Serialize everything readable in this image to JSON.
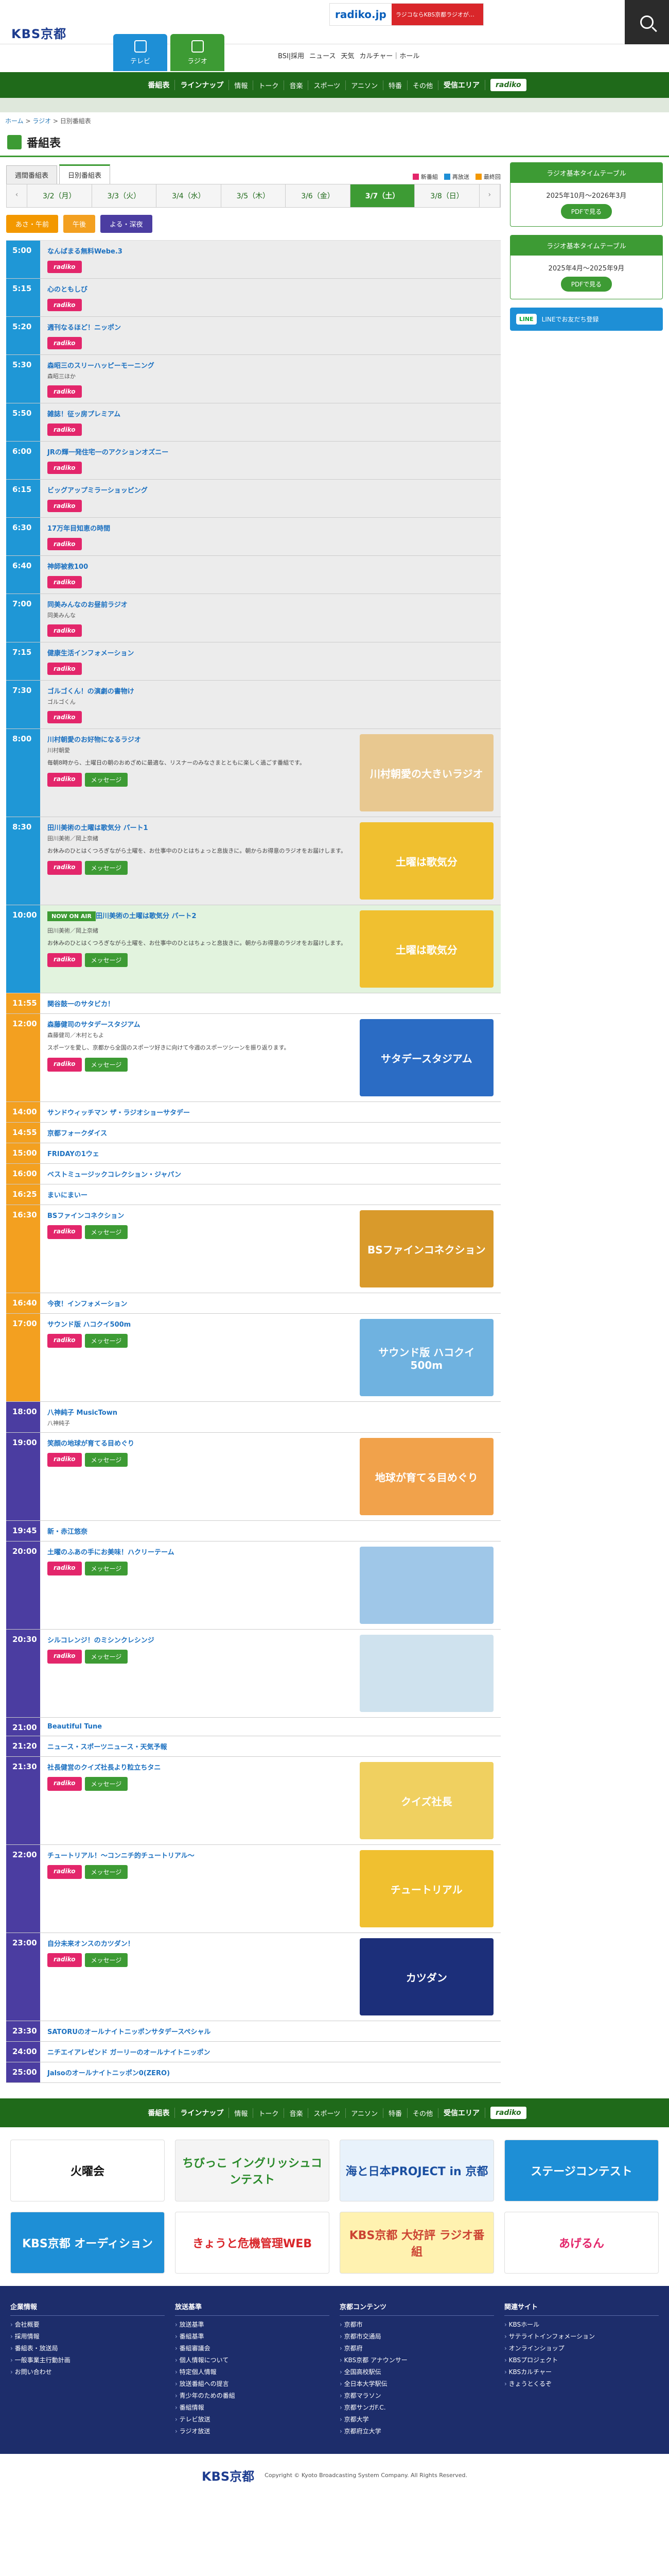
{
  "header": {
    "logo": "KBS京都",
    "tabs": [
      {
        "label": "テレビ"
      },
      {
        "label": "ラジオ"
      }
    ],
    "nav": [
      "BSI|採用",
      "ニュース",
      "天気",
      "カルチャー｜ホール"
    ],
    "radiko_logo": "radiko.jp",
    "radiko_text": "ラジコならKBS京都ラジオが…"
  },
  "greennav": {
    "items": [
      "番組表",
      "ラインナップ",
      "情報",
      "トーク",
      "音楽",
      "スポーツ",
      "アニソン",
      "特番",
      "その他",
      "受信エリア"
    ],
    "radiko": "radiko"
  },
  "breadcrumb": [
    "ホーム",
    "ラジオ",
    "日別番組表"
  ],
  "page": {
    "title": "番組表"
  },
  "viewtabs": [
    "週間番組表",
    "日別番組表"
  ],
  "legend": [
    {
      "label": "新番組",
      "color": "#e3266b"
    },
    {
      "label": "再放送",
      "color": "#1e8fd6"
    },
    {
      "label": "最終回",
      "color": "#f39800"
    }
  ],
  "days": [
    "3/2（月）",
    "3/3（火）",
    "3/4（水）",
    "3/5（木）",
    "3/6（金）",
    "3/7（土）",
    "3/8（日）"
  ],
  "dayparts": [
    "あさ・午前",
    "午後",
    "よる・深夜"
  ],
  "buttons": {
    "radiko": "radiko",
    "message": "メッセージ"
  },
  "programs": [
    {
      "time": "5:00",
      "title": "なんばまる無料Webe.3",
      "cast": "",
      "desc": "",
      "radiko": true,
      "msg": false,
      "band": "morning"
    },
    {
      "time": "5:15",
      "title": "心のともしび",
      "cast": "",
      "desc": "",
      "radiko": true,
      "msg": false,
      "band": "morning"
    },
    {
      "time": "5:20",
      "title": "週刊なるほど！ニッポン",
      "cast": "",
      "desc": "",
      "radiko": true,
      "msg": false,
      "band": "morning"
    },
    {
      "time": "5:30",
      "title": "森昭三のスリーハッピーモーニング",
      "cast": "森昭三ほか",
      "desc": "",
      "radiko": true,
      "msg": false,
      "band": "morning"
    },
    {
      "time": "5:50",
      "title": "雑誌！征ッ房プレミアム",
      "cast": "",
      "desc": "",
      "radiko": true,
      "msg": false,
      "band": "morning"
    },
    {
      "time": "6:00",
      "title": "JRの輝一発住宅一のアクションオズニー",
      "cast": "",
      "desc": "",
      "radiko": true,
      "msg": false,
      "band": "morning"
    },
    {
      "time": "6:15",
      "title": "ビッグアップミラーショッピング",
      "cast": "",
      "desc": "",
      "radiko": true,
      "msg": false,
      "band": "morning"
    },
    {
      "time": "6:30",
      "title": "17万年目知恵の時間",
      "cast": "",
      "desc": "",
      "radiko": true,
      "msg": false,
      "band": "morning"
    },
    {
      "time": "6:40",
      "title": "神師被救100",
      "cast": "",
      "desc": "",
      "radiko": true,
      "msg": false,
      "band": "morning"
    },
    {
      "time": "7:00",
      "title": "同美みんなのお昼前ラジオ",
      "cast": "同美みんな",
      "desc": "",
      "radiko": true,
      "msg": false,
      "band": "morning"
    },
    {
      "time": "7:15",
      "title": "健康生活インフォメーション",
      "cast": "",
      "desc": "",
      "radiko": true,
      "msg": false,
      "band": "morning"
    },
    {
      "time": "7:30",
      "title": "ゴルゴくん！の演劇の書物け",
      "cast": "ゴルゴくん",
      "desc": "",
      "radiko": true,
      "msg": false,
      "band": "morning"
    },
    {
      "time": "8:00",
      "title": "川村朝愛のお好物になるラジオ",
      "cast": "川村朝愛",
      "desc": "毎朝8時から、土曜日の朝のおめざめに最適な、リスナーのみなさまとともに楽しく過ごす番組です。",
      "radiko": true,
      "msg": true,
      "band": "morning",
      "img": "川村朝愛の大きいラジオ",
      "imgc": "#e8c890"
    },
    {
      "time": "8:30",
      "title": "田川美術の土曜は歌気分 パート1",
      "cast": "田川美術／岡上奈緒",
      "desc": "お休みのひとはくつろぎながら土曜を、お仕事中のひとはちょっと息抜きに。朝からお得意のラジオをお届けします。",
      "radiko": true,
      "msg": true,
      "band": "morning",
      "img": "土曜は歌気分",
      "imgc": "#f0c030"
    },
    {
      "time": "10:00",
      "title": "田川美術の土曜は歌気分 パート2",
      "cast": "田川美術／岡上奈緒",
      "desc": "お休みのひとはくつろぎながら土曜を、お仕事中のひとはちょっと息抜きに。朝からお得意のラジオをお届けします。",
      "radiko": true,
      "msg": true,
      "band": "morning",
      "live": true,
      "onair": "NOW ON AIR",
      "img": "土曜は歌気分",
      "imgc": "#f0c030"
    },
    {
      "time": "11:55",
      "title": "関谷鼓一のサタビカ！",
      "cast": "",
      "desc": "",
      "radiko": false,
      "msg": false,
      "band": "noon"
    },
    {
      "time": "12:00",
      "title": "森藤健司のサタデースタジアム",
      "cast": "森藤健司／木村ともよ",
      "desc": "スポーツを愛し、京都から全国のスポーツ好きに向けて今週のスポーツシーンを振り返ります。",
      "radiko": true,
      "msg": true,
      "band": "noon",
      "img": "サタデースタジアム",
      "imgc": "#2b6cc4"
    },
    {
      "time": "14:00",
      "title": "サンドウィッチマン ザ・ラジオショーサタデー",
      "cast": "",
      "desc": "",
      "radiko": false,
      "msg": false,
      "band": "noon"
    },
    {
      "time": "14:55",
      "title": "京都フォークダイス",
      "cast": "",
      "desc": "",
      "radiko": false,
      "msg": false,
      "band": "noon"
    },
    {
      "time": "15:00",
      "title": "FRIDAYの1ウェ",
      "cast": "",
      "desc": "",
      "radiko": false,
      "msg": false,
      "band": "noon"
    },
    {
      "time": "16:00",
      "title": "ベストミュージックコレクション・ジャパン",
      "cast": "",
      "desc": "",
      "radiko": false,
      "msg": false,
      "band": "noon"
    },
    {
      "time": "16:25",
      "title": "まいにまいー",
      "cast": "",
      "desc": "",
      "radiko": false,
      "msg": false,
      "band": "noon"
    },
    {
      "time": "16:30",
      "title": "BSファインコネクション",
      "cast": "",
      "desc": "",
      "radiko": true,
      "msg": true,
      "band": "noon",
      "img": "BSファインコネクション",
      "imgc": "#d99a2b"
    },
    {
      "time": "16:40",
      "title": "今夜！インフォメーション",
      "cast": "",
      "desc": "",
      "radiko": false,
      "msg": false,
      "band": "noon"
    },
    {
      "time": "17:00",
      "title": "サウンド版 ハコクイ500m",
      "cast": "",
      "desc": "",
      "radiko": true,
      "msg": true,
      "band": "noon",
      "img": "サウンド版 ハコクイ500m",
      "imgc": "#6fb2e0"
    },
    {
      "time": "18:00",
      "title": "八神純子 MusicTown",
      "cast": "八神純子",
      "desc": "",
      "radiko": false,
      "msg": false,
      "band": "night"
    },
    {
      "time": "19:00",
      "title": "笑顔の地球が育てる目めぐり",
      "cast": "",
      "desc": "",
      "radiko": true,
      "msg": true,
      "band": "night",
      "img": "地球が育てる目めぐり",
      "imgc": "#f1a24b"
    },
    {
      "time": "19:45",
      "title": "新・赤江悠奈",
      "cast": "",
      "desc": "",
      "radiko": false,
      "msg": false,
      "band": "night"
    },
    {
      "time": "20:00",
      "title": "土曜のふあの手にお美味！ハクリーテーム",
      "cast": "",
      "desc": "",
      "radiko": true,
      "msg": true,
      "band": "night",
      "img": "",
      "imgc": "#9fc7e8"
    },
    {
      "time": "20:30",
      "title": "シルコレンジ！のミシンクレシンジ",
      "cast": "",
      "desc": "",
      "radiko": true,
      "msg": true,
      "band": "night",
      "img": "",
      "imgc": "#cfe2ee"
    },
    {
      "time": "21:00",
      "title": "Beautiful Tune",
      "cast": "",
      "desc": "",
      "radiko": false,
      "msg": false,
      "band": "night"
    },
    {
      "time": "21:20",
      "title": "ニュース・スポーツニュース・天気予報",
      "cast": "",
      "desc": "",
      "radiko": false,
      "msg": false,
      "band": "night"
    },
    {
      "time": "21:30",
      "title": "社長健営のクイズ社長より粒立ちタニ",
      "cast": "",
      "desc": "",
      "radiko": true,
      "msg": true,
      "band": "night",
      "img": "クイズ社長",
      "imgc": "#f0d060"
    },
    {
      "time": "22:00",
      "title": "チュートリアル！～コンニチ的チュートリアル～",
      "cast": "",
      "desc": "",
      "radiko": true,
      "msg": true,
      "band": "night",
      "img": "チュートリアル",
      "imgc": "#f0c030"
    },
    {
      "time": "23:00",
      "title": "自分未来オンスのカツダン！",
      "cast": "",
      "desc": "",
      "radiko": true,
      "msg": true,
      "band": "night",
      "img": "カツダン",
      "imgc": "#1c2f7a"
    },
    {
      "time": "23:30",
      "title": "SATORUのオールナイトニッポンサタデースペシャル",
      "cast": "",
      "desc": "",
      "radiko": false,
      "msg": false,
      "band": "night"
    },
    {
      "time": "24:00",
      "title": "ニチエイアレゼンド ガーリーのオールナイトニッポン",
      "cast": "",
      "desc": "",
      "radiko": false,
      "msg": false,
      "band": "night"
    },
    {
      "time": "25:00",
      "title": "Jalsoのオールナイトニッポン0(ZERO)",
      "cast": "",
      "desc": "",
      "radiko": false,
      "msg": false,
      "band": "night"
    }
  ],
  "side": [
    {
      "head": "ラジオ基本タイムテーブル",
      "term": "2025年10月〜2026年3月",
      "btn": "PDFで見る"
    },
    {
      "head": "ラジオ基本タイムテーブル",
      "term": "2025年4月〜2025年9月",
      "btn": "PDFで見る"
    }
  ],
  "line": {
    "icon": "LINE",
    "text": "LINEでお友だち登録"
  },
  "banners": [
    {
      "label": "火曜会",
      "bg": "#fff",
      "fg": "#111"
    },
    {
      "label": "ちびっこ イングリッシュコンテスト",
      "bg": "#f4f4f4",
      "fg": "#2a8a2a"
    },
    {
      "label": "海と日本PROJECT in 京都",
      "bg": "#e8f2fb",
      "fg": "#1a4fa0"
    },
    {
      "label": "ステージコンテスト",
      "bg": "#1e8fd6",
      "fg": "#fff"
    },
    {
      "label": "KBS京都 オーディション",
      "bg": "#1e8fd6",
      "fg": "#fff"
    },
    {
      "label": "きょうと危機管理WEB",
      "bg": "#fff",
      "fg": "#d9262a"
    },
    {
      "label": "KBS京都 大好評 ラジオ番組",
      "bg": "#fff2b0",
      "fg": "#c43"
    },
    {
      "label": "あげるん",
      "bg": "#fff",
      "fg": "#e3266b"
    }
  ],
  "footer": [
    {
      "head": "企業情報",
      "items": [
        "会社概要",
        "採用情報",
        "番組表・放送局",
        "一般事業主行動計画",
        "お問い合わせ"
      ]
    },
    {
      "head": "放送基準",
      "items": [
        "放送基準",
        "番組基準",
        "番組審議会",
        "個人情報について",
        "特定個人情報",
        "放送番組への提言",
        "青少年のための番組",
        "番組情報",
        "テレビ放送",
        "ラジオ放送"
      ]
    },
    {
      "head": "京都コンテンツ",
      "items": [
        "京都市",
        "京都市交通局",
        "京都府",
        "KBS京都 アナウンサー",
        "全国高校駅伝",
        "全日本大学駅伝",
        "京都マラソン",
        "京都サンガF.C.",
        "京都大学",
        "京都府立大学"
      ]
    },
    {
      "head": "関連サイト",
      "items": [
        "KBSホール",
        "サテライトインフォメーション",
        "オンラインショップ",
        "KBSプロジェクト",
        "KBSカルチャー",
        "きょうとくるぞ"
      ]
    }
  ],
  "copyright": {
    "logo": "KBS京都",
    "text": "Copyright © Kyoto Broadcasting System Company. All Rights Reserved."
  }
}
